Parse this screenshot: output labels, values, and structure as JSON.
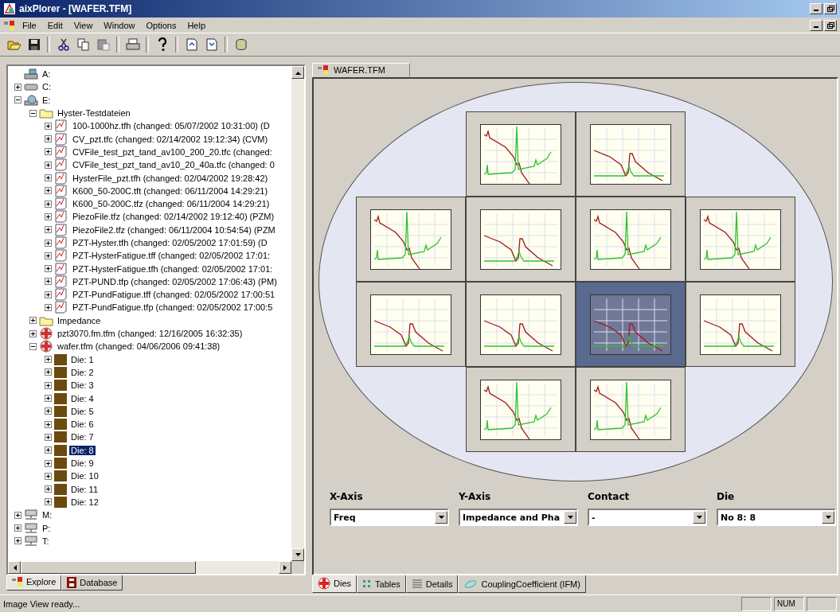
{
  "window": {
    "title": "aixPlorer - [WAFER.TFM]"
  },
  "menu": [
    "File",
    "Edit",
    "View",
    "Window",
    "Options",
    "Help"
  ],
  "tree": [
    {
      "kind": "floppy",
      "label": "A:"
    },
    {
      "kind": "disk",
      "label": "C:",
      "expanded": false
    },
    {
      "kind": "cd",
      "label": "E:",
      "expanded": true,
      "children": [
        {
          "kind": "folder",
          "label": "Hyster-Testdateien",
          "expanded": true,
          "children": [
            {
              "kind": "file",
              "label": "100-1000hz.tfh  (changed: 05/07/2002 10:31:00) (D",
              "expanded": false
            },
            {
              "kind": "file",
              "label": "CV_pzt.tfc  (changed: 02/14/2002 19:12:34) (CVM)",
              "expanded": false
            },
            {
              "kind": "file",
              "label": "CVFile_test_pzt_tand_av100_200_20.tfc  (changed:",
              "expanded": false
            },
            {
              "kind": "file",
              "label": "CVFile_test_pzt_tand_av10_20_40a.tfc  (changed: 0",
              "expanded": false
            },
            {
              "kind": "file",
              "label": "HysterFile_pzt.tfh  (changed: 02/04/2002 19:28:42)",
              "expanded": false
            },
            {
              "kind": "file",
              "label": "K600_50-200C.tft  (changed: 06/11/2004 14:29:21)",
              "expanded": false
            },
            {
              "kind": "file",
              "label": "K600_50-200C.tfz  (changed: 06/11/2004 14:29:21)",
              "expanded": false
            },
            {
              "kind": "file",
              "label": "PiezoFile.tfz  (changed: 02/14/2002 19:12:40) (PZM)",
              "expanded": false
            },
            {
              "kind": "file",
              "label": "PiezoFile2.tfz  (changed: 06/11/2004 10:54:54) (PZM",
              "expanded": false
            },
            {
              "kind": "file",
              "label": "PZT-Hyster.tfh  (changed: 02/05/2002 17:01:59) (D",
              "expanded": false
            },
            {
              "kind": "file",
              "label": "PZT-HysterFatigue.tff  (changed: 02/05/2002 17:01:",
              "expanded": false
            },
            {
              "kind": "file",
              "label": "PZT-HysterFatigue.tfh  (changed: 02/05/2002 17:01:",
              "expanded": false
            },
            {
              "kind": "file",
              "label": "PZT-PUND.tfp  (changed: 02/05/2002 17:06:43) (PM)",
              "expanded": false
            },
            {
              "kind": "file",
              "label": "PZT-PundFatigue.tff  (changed: 02/05/2002 17:00:51",
              "expanded": false
            },
            {
              "kind": "file",
              "label": "PZT-PundFatigue.tfp  (changed: 02/05/2002 17:00:5",
              "expanded": false
            }
          ]
        },
        {
          "kind": "folder",
          "label": "Impedance",
          "expanded": false
        },
        {
          "kind": "wafer",
          "label": "pzt3070.fm.tfm  (changed: 12/16/2005 16:32:35)",
          "expanded": false
        },
        {
          "kind": "wafer",
          "label": "wafer.tfm  (changed: 04/06/2006 09:41:38)",
          "expanded": true,
          "children": [
            {
              "kind": "die",
              "label": "Die: 1",
              "expanded": false,
              "selected": false
            },
            {
              "kind": "die",
              "label": "Die: 2",
              "expanded": false,
              "selected": false
            },
            {
              "kind": "die",
              "label": "Die: 3",
              "expanded": false,
              "selected": false
            },
            {
              "kind": "die",
              "label": "Die: 4",
              "expanded": false,
              "selected": false
            },
            {
              "kind": "die",
              "label": "Die: 5",
              "expanded": false,
              "selected": false
            },
            {
              "kind": "die",
              "label": "Die: 6",
              "expanded": false,
              "selected": false
            },
            {
              "kind": "die",
              "label": "Die: 7",
              "expanded": false,
              "selected": false
            },
            {
              "kind": "die",
              "label": "Die: 8",
              "expanded": false,
              "selected": true
            },
            {
              "kind": "die",
              "label": "Die: 9",
              "expanded": false,
              "selected": false
            },
            {
              "kind": "die",
              "label": "Die: 10",
              "expanded": false,
              "selected": false
            },
            {
              "kind": "die",
              "label": "Die: 11",
              "expanded": false,
              "selected": false
            },
            {
              "kind": "die",
              "label": "Die: 12",
              "expanded": false,
              "selected": false
            }
          ]
        }
      ]
    },
    {
      "kind": "network",
      "label": "M:",
      "expanded": false
    },
    {
      "kind": "network",
      "label": "P:",
      "expanded": false
    },
    {
      "kind": "network",
      "label": "T:",
      "expanded": false
    }
  ],
  "left_tabs": [
    {
      "label": "Explore",
      "selected": true
    },
    {
      "label": "Database",
      "selected": false
    }
  ],
  "document_tab": {
    "label": "WAFER.TFM"
  },
  "dies": [
    {
      "kind": "spiky",
      "selected": false
    },
    {
      "kind": "smooth",
      "selected": false
    },
    {
      "kind": "spiky",
      "selected": false
    },
    {
      "kind": "smooth",
      "selected": false
    },
    {
      "kind": "spiky",
      "selected": false
    },
    {
      "kind": "spiky",
      "selected": false
    },
    {
      "kind": "smooth",
      "selected": false
    },
    {
      "kind": "smooth",
      "selected": false
    },
    {
      "kind": "smooth",
      "selected": true
    },
    {
      "kind": "smooth",
      "selected": false
    },
    {
      "kind": "spiky",
      "selected": false
    },
    {
      "kind": "spiky",
      "selected": false
    }
  ],
  "selectors": [
    {
      "label": "X-Axis",
      "value": "Freq"
    },
    {
      "label": "Y-Axis",
      "value": "Impedance and Pha"
    },
    {
      "label": "Contact",
      "value": "-"
    },
    {
      "label": "Die",
      "value": "No 8: 8"
    }
  ],
  "view_tabs": [
    {
      "label": "Dies",
      "selected": true
    },
    {
      "label": "Tables",
      "selected": false
    },
    {
      "label": "Details",
      "selected": false
    },
    {
      "label": "CouplingCoefficient (IFM)",
      "selected": false
    }
  ],
  "status_bar": {
    "message": "Image View ready...",
    "panes": [
      "NUM"
    ]
  }
}
